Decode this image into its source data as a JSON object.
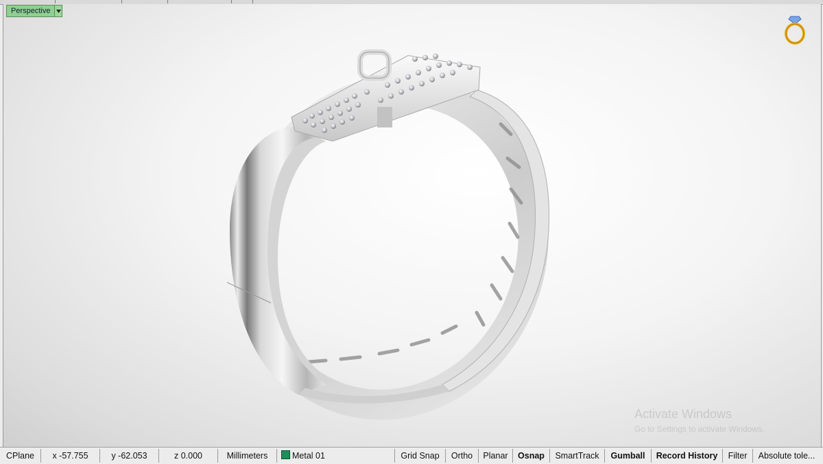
{
  "viewport": {
    "name": "Perspective",
    "dropdown_icon": "chevron-down-icon",
    "watermark": {
      "title": "Activate Windows",
      "subtitle": "Go to Settings to activate Windows."
    },
    "logo_icon": "diamond-ring-icon"
  },
  "status": {
    "cplane": "CPlane",
    "x": "x -57.755",
    "y": "y -62.053",
    "z": "z 0.000",
    "units": "Millimeters",
    "layer": "Metal 01",
    "layer_color": "#1e8f5a",
    "toggles": [
      {
        "label": "Grid Snap",
        "active": false
      },
      {
        "label": "Ortho",
        "active": false
      },
      {
        "label": "Planar",
        "active": false
      },
      {
        "label": "Osnap",
        "active": true
      },
      {
        "label": "SmartTrack",
        "active": false
      },
      {
        "label": "Gumball",
        "active": true
      },
      {
        "label": "Record History",
        "active": true
      },
      {
        "label": "Filter",
        "active": false
      }
    ],
    "tolerance": "Absolute tole..."
  }
}
